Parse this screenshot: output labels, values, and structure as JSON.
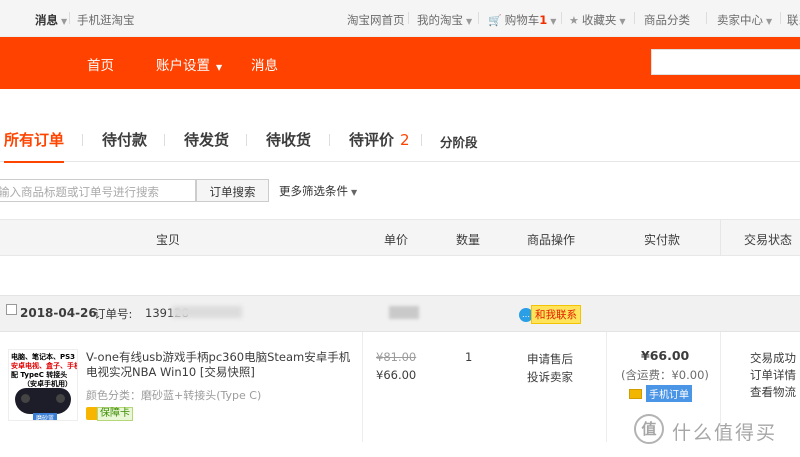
{
  "topbar": {
    "messages": "消息",
    "mobile_taobao": "手机逛淘宝",
    "home": "淘宝网首页",
    "my_taobao": "我的淘宝",
    "cart_label": "购物车",
    "cart_count": "1",
    "favorites": "收藏夹",
    "categories": "商品分类",
    "seller_center": "卖家中心",
    "contact_service": "联系"
  },
  "navbar": {
    "home": "首页",
    "account_settings": "账户设置",
    "messages": "消息"
  },
  "tabs": [
    {
      "label": "所有订单"
    },
    {
      "label": "待付款"
    },
    {
      "label": "待发货"
    },
    {
      "label": "待收货"
    },
    {
      "label": "待评价",
      "count": "2"
    },
    {
      "label": "分阶段"
    }
  ],
  "search": {
    "placeholder": "输入商品标题或订单号进行搜索",
    "button": "订单搜索",
    "more_filters": "更多筛选条件"
  },
  "table_header": {
    "item": "宝贝",
    "price": "单价",
    "quantity": "数量",
    "operations": "商品操作",
    "paid": "实付款",
    "status": "交易状态"
  },
  "order": {
    "date": "2018-04-26",
    "order_no_label": "订单号:",
    "order_no": "139128",
    "contact_me": "和我联系",
    "thumb": {
      "line1": "电脑、笔记本、PS3",
      "line2": "安卓电视、盒子、手机",
      "line3": "配 TypeC 转接头",
      "line4": "（安卓手机用）",
      "badge": "磨砂蓝"
    },
    "title": "V-one有线usb游戏手柄pc360电脑Steam安卓手机电视实况NBA Win10 [交易快照]",
    "attr_label": "颜色分类：",
    "attr_value": "磨砂蓝+转接头(Type C)",
    "guarantee": "保障卡",
    "price_original": "¥81.00",
    "price_current": "¥66.00",
    "quantity": "1",
    "op_after_sale": "申请售后",
    "op_complain": "投诉卖家",
    "paid": "¥66.00",
    "shipping": "(含运费：¥0.00)",
    "mobile_order": "手机订单",
    "status_success": "交易成功",
    "status_detail": "订单详情",
    "status_logistics": "查看物流"
  },
  "watermark": {
    "logo": "值",
    "text": "什么值得买"
  }
}
